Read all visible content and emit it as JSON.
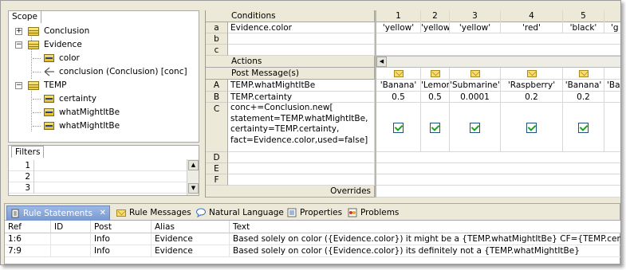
{
  "scope": {
    "tab": "Scope",
    "nodes": [
      {
        "label": "Conclusion"
      },
      {
        "label": "Evidence"
      },
      {
        "label": "color"
      },
      {
        "label": "conclusion (Conclusion) [conc]"
      },
      {
        "label": "TEMP"
      },
      {
        "label": "certainty"
      },
      {
        "label": "whatMightItBe"
      },
      {
        "label": "whatMightItBe"
      }
    ]
  },
  "filters": {
    "tab": "Filters",
    "rows": [
      "1",
      "2",
      "3"
    ]
  },
  "table": {
    "conditions_label": "Conditions",
    "actions_label": "Actions",
    "post_message_label": "Post Message(s)",
    "overrides_label": "Overrides",
    "columns": [
      "1",
      "2",
      "3",
      "4",
      "5"
    ],
    "condition_rows": [
      {
        "id": "a",
        "expr": "Evidence.color",
        "values": [
          "'yellow'",
          "'yellow'",
          "'yellow'",
          "'red'",
          "'black'",
          "'g"
        ]
      },
      {
        "id": "b",
        "expr": "",
        "values": []
      },
      {
        "id": "c",
        "expr": "",
        "values": []
      }
    ],
    "action_rows": [
      {
        "id": "A",
        "expr": "TEMP.whatMightItBe",
        "values": [
          "'Banana'",
          "'Lemon'",
          "'Submarine'",
          "'Raspberry'",
          "'Banana'",
          "'Ba"
        ]
      },
      {
        "id": "B",
        "expr": "TEMP.certainty",
        "values": [
          "0.5",
          "0.5",
          "0.0001",
          "0.2",
          "0.2",
          ""
        ]
      },
      {
        "id": "C",
        "expr_lines": [
          "conc+=Conclusion.new[",
          "statement=TEMP.whatMightItBe,",
          "certainty=TEMP.certainty,",
          "fact=Evidence.color,used=false]"
        ]
      },
      {
        "id": "D",
        "expr": ""
      },
      {
        "id": "E",
        "expr": ""
      },
      {
        "id": "F",
        "expr": ""
      }
    ]
  },
  "bottom": {
    "tabs": [
      {
        "label": "Rule Statements"
      },
      {
        "label": "Rule Messages"
      },
      {
        "label": "Natural Language"
      },
      {
        "label": "Properties"
      },
      {
        "label": "Problems"
      }
    ],
    "close_glyph": "✕",
    "columns": [
      "Ref",
      "ID",
      "Post",
      "Alias",
      "Text"
    ],
    "rows": [
      {
        "ref": "1:6",
        "id": "",
        "post": "Info",
        "alias": "Evidence",
        "text": "Based solely on color ({Evidence.color}) it might be a {TEMP.whatMightItBe} CF={TEMP.certainty}"
      },
      {
        "ref": "7:9",
        "id": "",
        "post": "Info",
        "alias": "Evidence",
        "text": "Based solely on color ({Evidence.color}) its definitely not a {TEMP.whatMightItBe}"
      }
    ]
  },
  "glyphs": {
    "plus": "+",
    "minus": "−",
    "up": "▲",
    "down": "▼",
    "left": "◀"
  }
}
